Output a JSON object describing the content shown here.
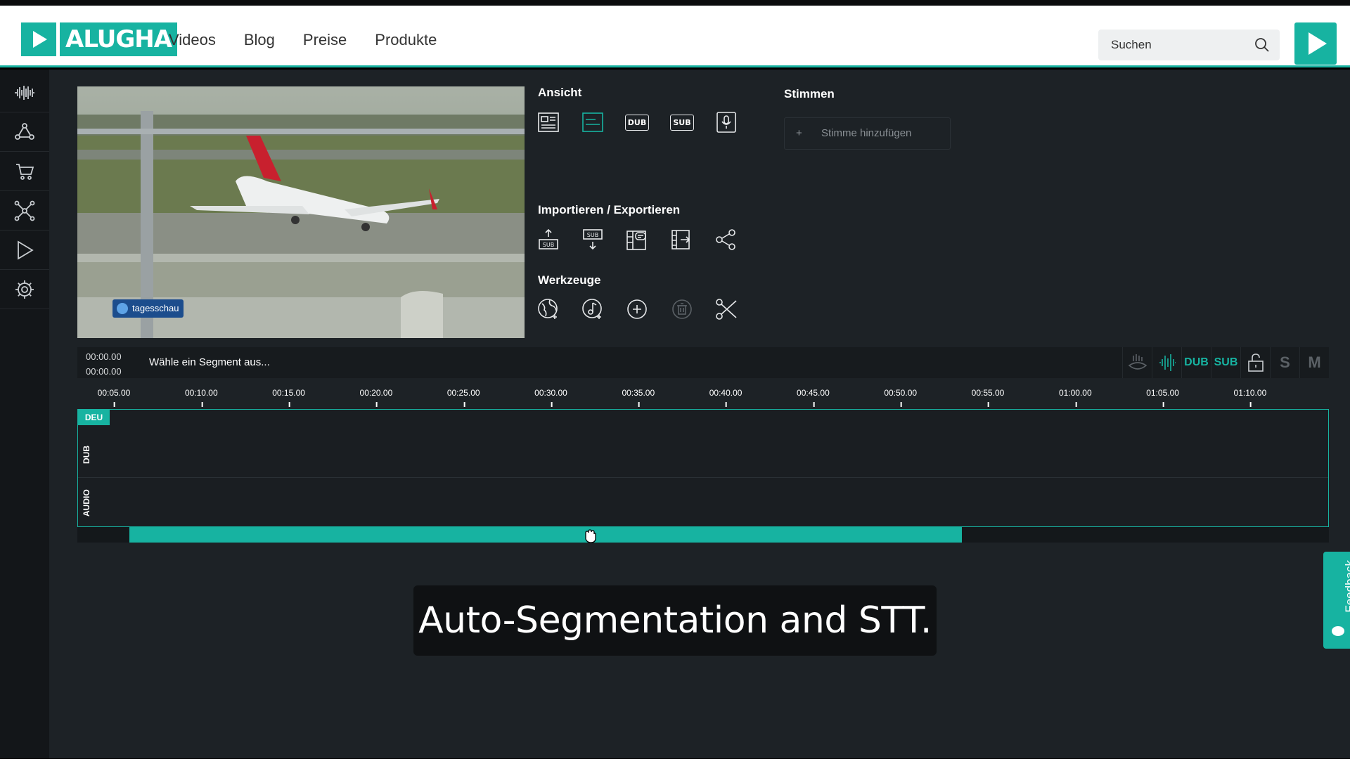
{
  "brand": {
    "name": "ALUGHA",
    "accent": "#17b3a1"
  },
  "nav": {
    "items": [
      "Videos",
      "Blog",
      "Preise",
      "Produkte"
    ]
  },
  "search": {
    "placeholder": "Suchen"
  },
  "sidebar": {
    "icons": [
      "waveform-icon",
      "network-icon",
      "cart-icon",
      "graph-icon",
      "play-icon",
      "gear-icon"
    ]
  },
  "video": {
    "channel_tag": "tagesschau"
  },
  "panels": {
    "ansicht": {
      "title": "Ansicht",
      "labels": {
        "dub": "DUB",
        "sub": "SUB"
      }
    },
    "import_export": {
      "title": "Importieren / Exportieren",
      "sub": "SUB"
    },
    "werkzeuge": {
      "title": "Werkzeuge"
    },
    "stimmen": {
      "title": "Stimmen",
      "add_voice": "Stimme hinzufügen"
    }
  },
  "timeline": {
    "time_start": "00:00.00",
    "time_end": "00:00.00",
    "message": "Wähle ein Segment aus...",
    "tools": {
      "dub": "DUB",
      "sub": "SUB",
      "solo": "S",
      "mute": "M"
    },
    "ticks": [
      "00:05.00",
      "00:10.00",
      "00:15.00",
      "00:20.00",
      "00:25.00",
      "00:30.00",
      "00:35.00",
      "00:40.00",
      "00:45.00",
      "00:50.00",
      "00:55.00",
      "01:00.00",
      "01:05.00",
      "01:10.00"
    ],
    "language": "DEU",
    "tracks": [
      "DUB",
      "AUDIO"
    ]
  },
  "caption": "Auto-Segmentation and STT.",
  "feedback": "Feedback"
}
